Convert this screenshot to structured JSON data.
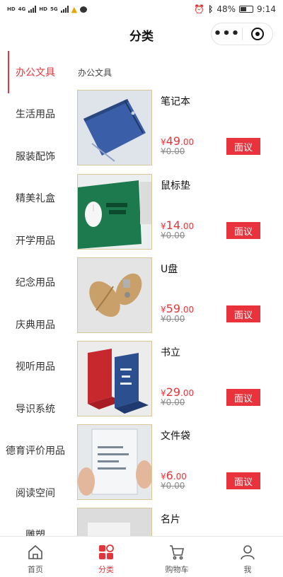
{
  "status": {
    "sim1": "HD",
    "sim2": "HD",
    "net1": "4G",
    "net2": "5G",
    "battery": "48%",
    "time": "9:14"
  },
  "header": {
    "title": "分类"
  },
  "sidebar": {
    "items": [
      {
        "label": "办公文具",
        "active": true
      },
      {
        "label": "生活用品"
      },
      {
        "label": "服装配饰"
      },
      {
        "label": "精美礼盒"
      },
      {
        "label": "开学用品"
      },
      {
        "label": "纪念用品"
      },
      {
        "label": "庆典用品"
      },
      {
        "label": "视听用品"
      },
      {
        "label": "导识系统"
      },
      {
        "label": "德育评价用品"
      },
      {
        "label": "阅读空间"
      },
      {
        "label": "雕塑"
      }
    ]
  },
  "content": {
    "section_title": "办公文具",
    "products": [
      {
        "name": "笔记本",
        "currency": "¥",
        "price_int": "49",
        "price_dec": ".00",
        "original": "¥0.00",
        "button": "面议"
      },
      {
        "name": "鼠标垫",
        "currency": "¥",
        "price_int": "14",
        "price_dec": ".00",
        "original": "¥0.00",
        "button": "面议"
      },
      {
        "name": "U盘",
        "currency": "¥",
        "price_int": "59",
        "price_dec": ".00",
        "original": "¥0.00",
        "button": "面议"
      },
      {
        "name": "书立",
        "currency": "¥",
        "price_int": "29",
        "price_dec": ".00",
        "original": "¥0.00",
        "button": "面议"
      },
      {
        "name": "文件袋",
        "currency": "¥",
        "price_int": "6",
        "price_dec": ".00",
        "original": "¥0.00",
        "button": "面议"
      },
      {
        "name": "名片"
      }
    ]
  },
  "tabbar": {
    "items": [
      {
        "label": "首页",
        "icon": "home-icon"
      },
      {
        "label": "分类",
        "icon": "category-icon",
        "active": true
      },
      {
        "label": "购物车",
        "icon": "cart-icon"
      },
      {
        "label": "我",
        "icon": "user-icon"
      }
    ]
  },
  "colors": {
    "accent": "#e3363c",
    "button": "#e8323c",
    "thumb_border": "#d9c79a"
  }
}
